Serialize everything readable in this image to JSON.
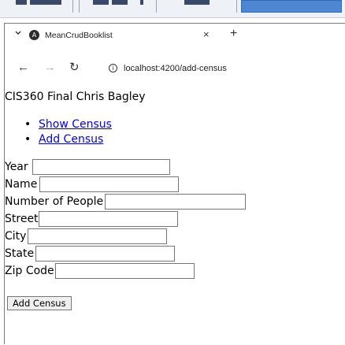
{
  "browser": {
    "tab": {
      "favicon_glyph": "A",
      "title": "MeanCrudBooklist",
      "close_glyph": "×",
      "new_tab_glyph": "+"
    },
    "nav": {
      "back_glyph": "←",
      "forward_glyph": "→",
      "reload_glyph": "↻",
      "site_info_glyph": "i"
    },
    "url": "localhost:4200/add-census"
  },
  "page": {
    "title": "CIS360 Final Chris Bagley",
    "nav_links": [
      {
        "label": "Show Census"
      },
      {
        "label": "Add Census"
      }
    ],
    "form": {
      "fields": [
        {
          "label": "Year",
          "value": ""
        },
        {
          "label": "Name",
          "value": ""
        },
        {
          "label": "Number of People",
          "value": ""
        },
        {
          "label": "Street",
          "value": ""
        },
        {
          "label": "City",
          "value": ""
        },
        {
          "label": "State",
          "value": ""
        },
        {
          "label": "Zip Code",
          "value": ""
        }
      ],
      "submit_label": "Add Census"
    }
  },
  "colors": {
    "link": "#0000ee",
    "taskbar_active": "#4f86d1"
  }
}
